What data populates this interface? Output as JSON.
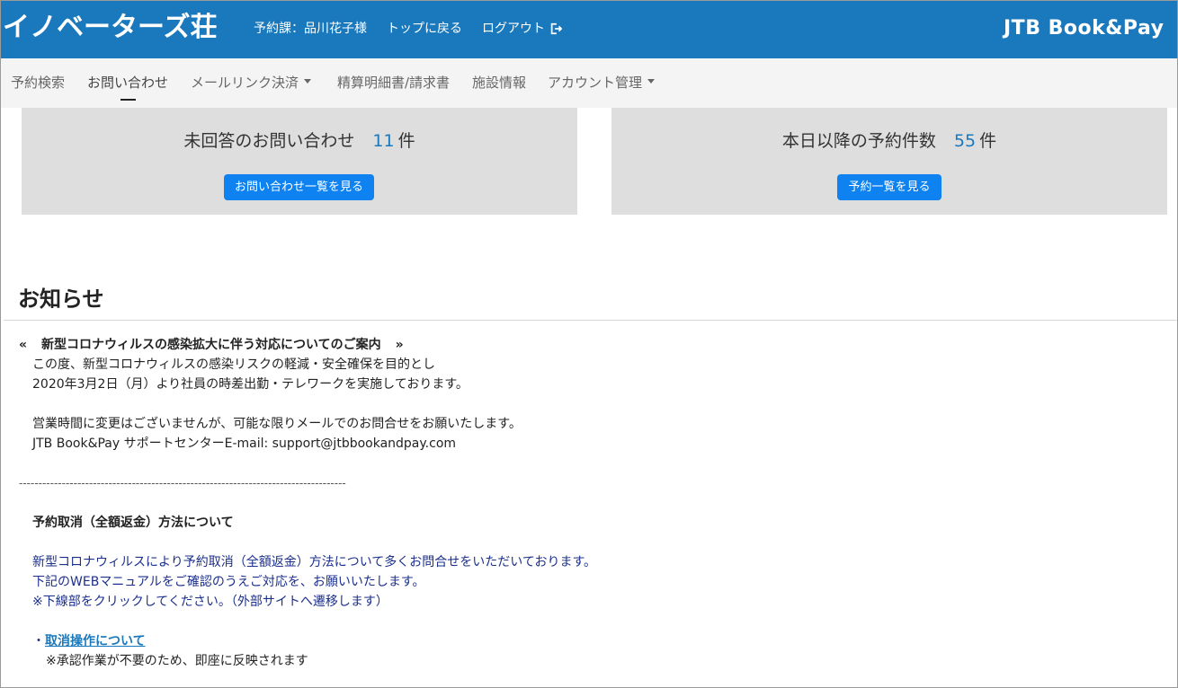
{
  "header": {
    "brand": "イノベーターズ荘",
    "user_label": "予約課：品川花子様",
    "top_link": "トップに戻る",
    "logout_link": "ログアウト",
    "logo_text": "JTB Book&Pay"
  },
  "nav": {
    "items": [
      {
        "label": "予約検索"
      },
      {
        "label": "お問い合わせ"
      },
      {
        "label": "メールリンク決済"
      },
      {
        "label": "精算明細書/請求書"
      },
      {
        "label": "施設情報"
      },
      {
        "label": "アカウント管理"
      }
    ],
    "active_index": 1
  },
  "cards": {
    "inquiries": {
      "label": "未回答のお問い合わせ",
      "count": "11",
      "unit": "件",
      "button": "お問い合わせ一覧を見る"
    },
    "reservations": {
      "label": "本日以降の予約件数",
      "count": "55",
      "unit": "件",
      "button": "予約一覧を見る"
    }
  },
  "notices": {
    "title": "お知らせ",
    "prev": "«",
    "next": "»",
    "heading": "新型コロナウィルスの感染拡大に伴う対応についてのご案内",
    "lines": [
      "この度、新型コロナウィルスの感染リスクの軽減・安全確保を目的とし",
      "2020年3月2日（月）より社員の時差出勤・テレワークを実施しております。",
      "営業時間に変更はございませんが、可能な限りメールでのお問合せをお願いたします。",
      "JTB Book&Pay サポートセンターE-mail: support@jtbbookandpay.com"
    ],
    "separator": "------------------------------------------------------------------------------------",
    "subheading": "予約取消（全額返金）方法について",
    "blue_lines": [
      "新型コロナウィルスにより予約取消（全額返金）方法について多くお問合せをいただいております。",
      "下記のWEBマニュアルをご確認のうえご対応を、お願いいたします。",
      "※下線部をクリックしてください。（外部サイトへ遷移します）"
    ],
    "bullet": "・",
    "link_text": "取消操作について",
    "link_note": "※承認作業が不要のため、即座に反映されます"
  }
}
